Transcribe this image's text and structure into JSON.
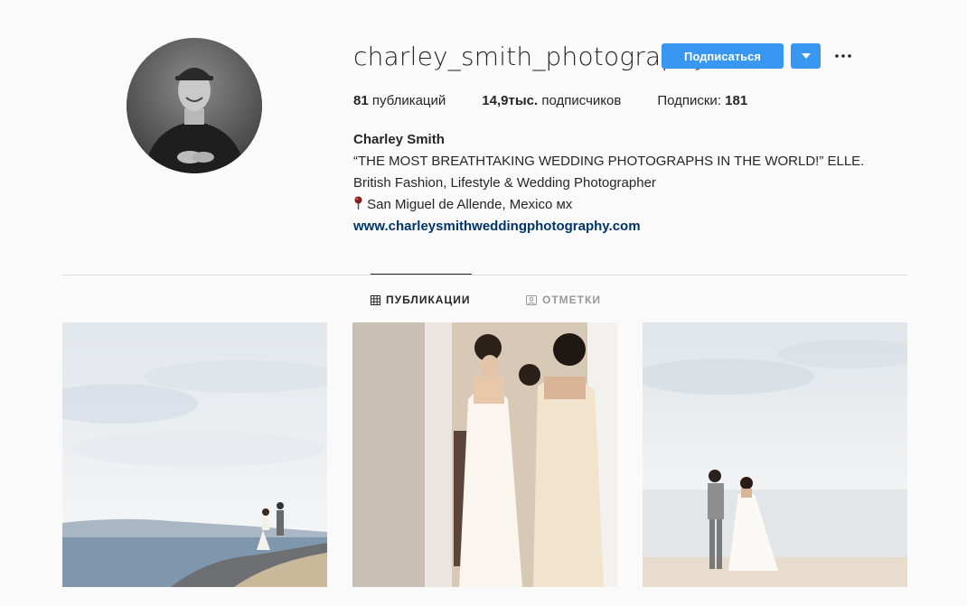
{
  "profile": {
    "username": "charley_smith_photography",
    "follow_label": "Подписаться",
    "avatar_icon": "profile-photo"
  },
  "stats": {
    "posts_count": "81",
    "posts_label": "публикаций",
    "followers_count": "14,9тыс.",
    "followers_label": "подписчиков",
    "following_label": "Подписки:",
    "following_count": "181"
  },
  "bio": {
    "full_name": "Charley Smith",
    "line1": "“THE MOST BREATHTAKING WEDDING PHOTOGRAPHS IN THE WORLD!” ELLE.",
    "line2": "British Fashion, Lifestyle & Wedding Photographer",
    "location": "San Miguel de Allende, Mexico мх",
    "website": "www.charleysmithweddingphotography.com"
  },
  "tabs": [
    {
      "label": "ПУБЛИКАЦИИ",
      "icon": "grid-icon",
      "active": true
    },
    {
      "label": "ОТМЕТКИ",
      "icon": "tagged-icon",
      "active": false
    }
  ],
  "colors": {
    "accent": "#3897f0",
    "link": "#003569",
    "background": "#fafafa"
  }
}
